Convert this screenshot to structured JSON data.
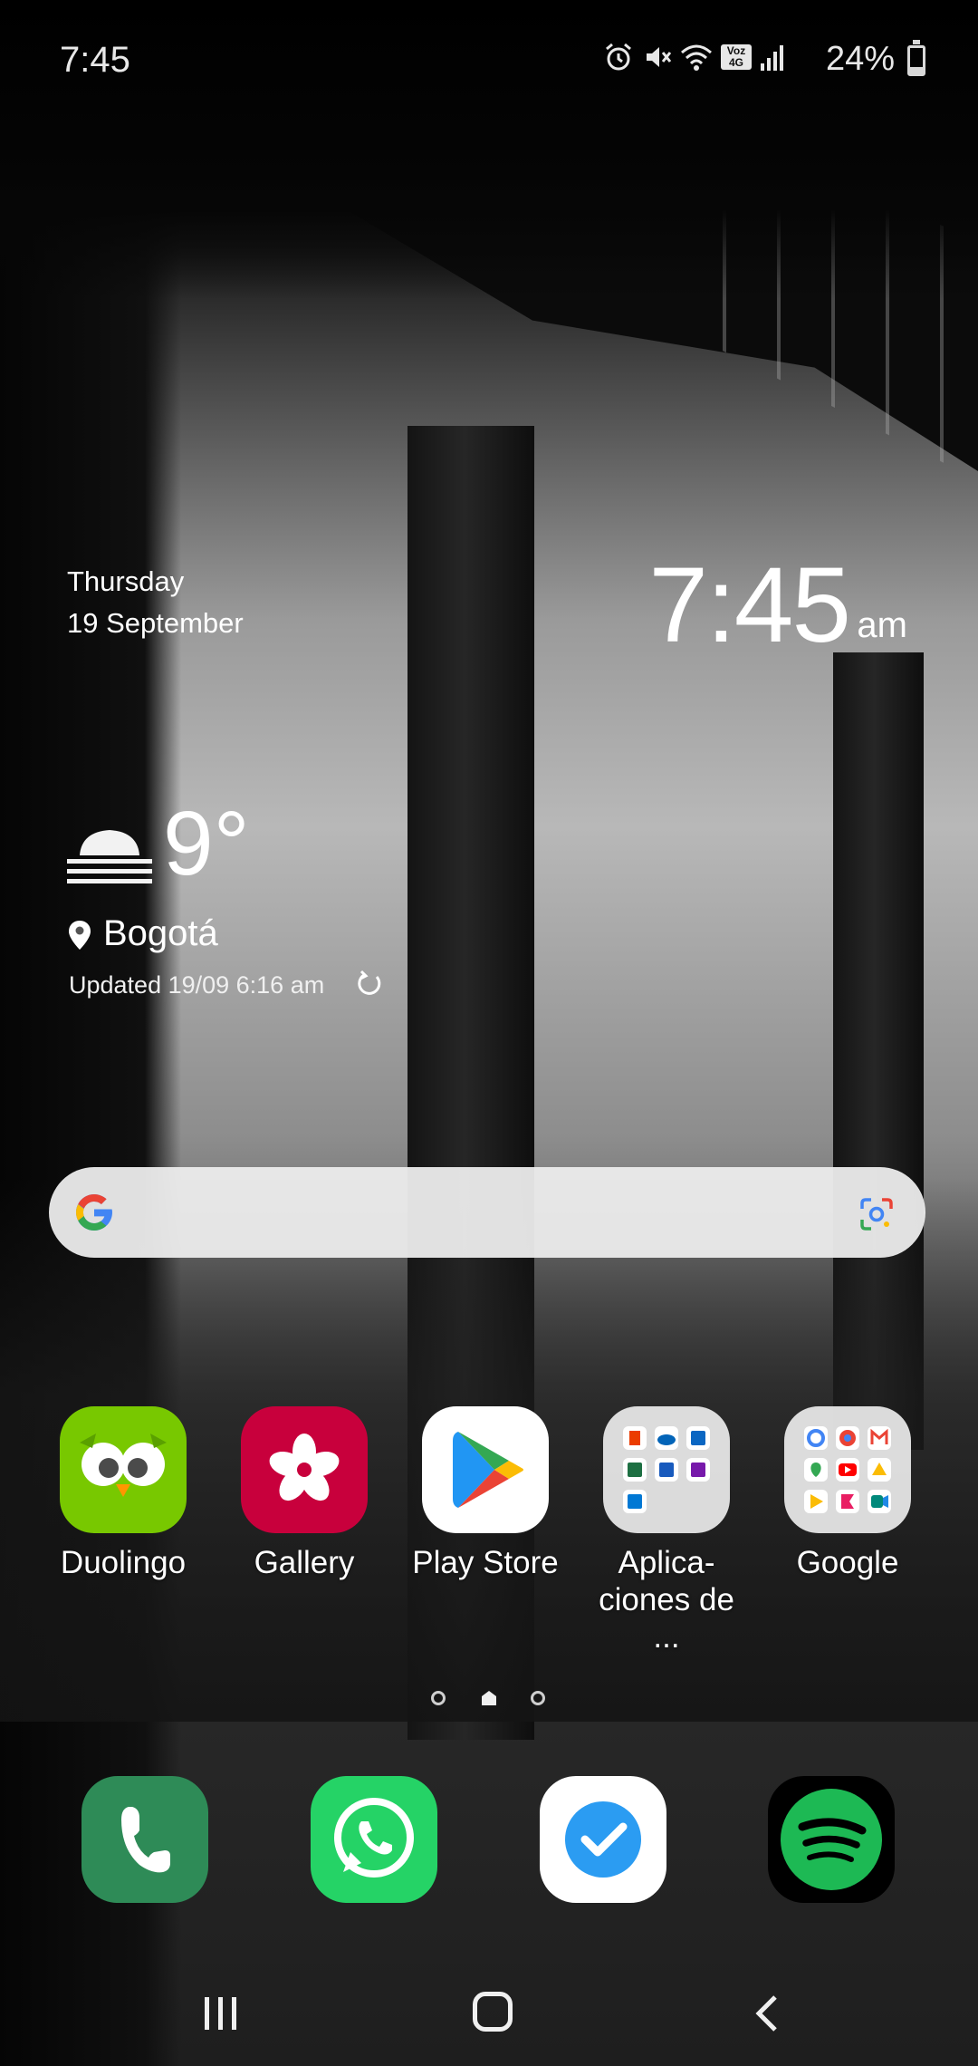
{
  "status_bar": {
    "time": "7:45",
    "network_label": "Voz 4G",
    "battery_percent": "24%",
    "battery_level": 0.24,
    "icons": [
      "alarm-icon",
      "mute-icon",
      "wifi-icon",
      "volte-4g-icon",
      "signal-icon",
      "battery-icon"
    ]
  },
  "clock_widget": {
    "day": "Thursday",
    "date": "19 September",
    "time": "7:45",
    "ampm": "am"
  },
  "weather_widget": {
    "icon": "fog-icon",
    "temperature": "9°",
    "city": "Bogotá",
    "updated": "Updated 19/09 6:16 am"
  },
  "search_bar": {
    "left_icon": "google-g-icon",
    "right_icon": "google-lens-icon"
  },
  "apps": [
    {
      "label": "Duolingo",
      "icon": "duolingo-icon"
    },
    {
      "label": "Gallery",
      "icon": "gallery-icon"
    },
    {
      "label": "Play Store",
      "icon": "play-store-icon"
    },
    {
      "label": "Aplica-\nciones de ...",
      "icon": "microsoft-folder-icon"
    },
    {
      "label": "Google",
      "icon": "google-folder-icon"
    }
  ],
  "page_indicator": {
    "pages": 3,
    "current": 2
  },
  "dock": [
    {
      "icon": "phone-icon"
    },
    {
      "icon": "whatsapp-icon"
    },
    {
      "icon": "tasks-check-icon"
    },
    {
      "icon": "spotify-icon"
    }
  ],
  "navigation": [
    "recent-apps-icon",
    "home-icon",
    "back-icon"
  ],
  "colors": {
    "duolingo": "#78c800",
    "gallery": "#c8003c",
    "phone": "#2e8b57",
    "whatsapp": "#25d366",
    "spotify": "#1db954",
    "tasks": "#2b9cf2"
  }
}
